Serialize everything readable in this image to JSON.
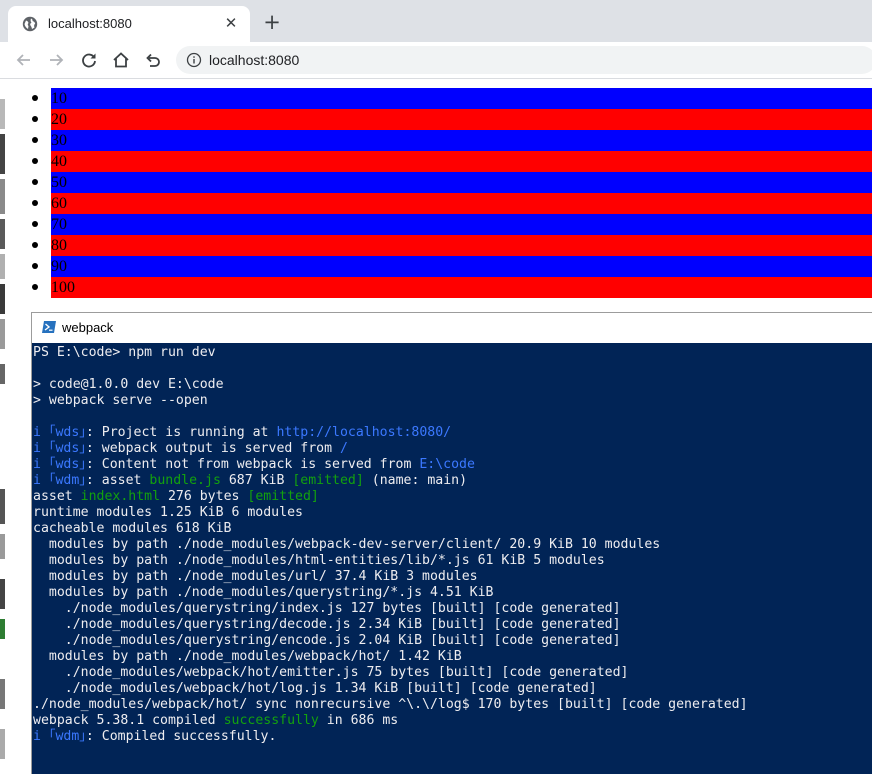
{
  "browser": {
    "tab": {
      "title": "localhost:8080",
      "close": "✕"
    },
    "new_tab": "+",
    "address": {
      "url": "localhost:8080"
    }
  },
  "page": {
    "items": [
      "10",
      "20",
      "30",
      "40",
      "50",
      "60",
      "70",
      "80",
      "90",
      "100"
    ],
    "colors": {
      "odd": "#0000ff",
      "even": "#ff0000"
    }
  },
  "terminal": {
    "title": "webpack",
    "colors": {
      "background": "#012456",
      "text": "#eeedf0",
      "blue": "#3b78ff",
      "green": "#13a10e"
    },
    "lines": [
      {
        "text": "PS E:\\code> npm run dev"
      },
      {
        "text": ""
      },
      {
        "text": "> code@1.0.0 dev E:\\code"
      },
      {
        "text": "> webpack serve --open"
      },
      {
        "text": ""
      },
      {
        "segments": [
          {
            "t": "i ｢wds｣",
            "c": "blue"
          },
          {
            "t": ": Project is running at "
          },
          {
            "t": "http://localhost:8080/",
            "c": "blue"
          }
        ]
      },
      {
        "segments": [
          {
            "t": "i ｢wds｣",
            "c": "blue"
          },
          {
            "t": ": webpack output is served from "
          },
          {
            "t": "/",
            "c": "blue"
          }
        ]
      },
      {
        "segments": [
          {
            "t": "i ｢wds｣",
            "c": "blue"
          },
          {
            "t": ": Content not from webpack is served from "
          },
          {
            "t": "E:\\code",
            "c": "blue"
          }
        ]
      },
      {
        "segments": [
          {
            "t": "i ｢wdm｣",
            "c": "blue"
          },
          {
            "t": ": asset "
          },
          {
            "t": "bundle.js",
            "c": "green"
          },
          {
            "t": " 687 KiB "
          },
          {
            "t": "[emitted]",
            "c": "green"
          },
          {
            "t": " (name: main)"
          }
        ]
      },
      {
        "segments": [
          {
            "t": "asset "
          },
          {
            "t": "index.html",
            "c": "green"
          },
          {
            "t": " 276 bytes "
          },
          {
            "t": "[emitted]",
            "c": "green"
          }
        ]
      },
      {
        "text": "runtime modules 1.25 KiB 6 modules"
      },
      {
        "text": "cacheable modules 618 KiB"
      },
      {
        "text": "  modules by path ./node_modules/webpack-dev-server/client/ 20.9 KiB 10 modules"
      },
      {
        "text": "  modules by path ./node_modules/html-entities/lib/*.js 61 KiB 5 modules"
      },
      {
        "text": "  modules by path ./node_modules/url/ 37.4 KiB 3 modules"
      },
      {
        "text": "  modules by path ./node_modules/querystring/*.js 4.51 KiB"
      },
      {
        "text": "    ./node_modules/querystring/index.js 127 bytes [built] [code generated]"
      },
      {
        "text": "    ./node_modules/querystring/decode.js 2.34 KiB [built] [code generated]"
      },
      {
        "text": "    ./node_modules/querystring/encode.js 2.04 KiB [built] [code generated]"
      },
      {
        "text": "  modules by path ./node_modules/webpack/hot/ 1.42 KiB"
      },
      {
        "text": "    ./node_modules/webpack/hot/emitter.js 75 bytes [built] [code generated]"
      },
      {
        "text": "    ./node_modules/webpack/hot/log.js 1.34 KiB [built] [code generated]"
      },
      {
        "text": "./node_modules/webpack/hot/ sync nonrecursive ^\\.\\/log$ 170 bytes [built] [code generated]"
      },
      {
        "segments": [
          {
            "t": "webpack 5.38.1 compiled "
          },
          {
            "t": "successfully",
            "c": "green"
          },
          {
            "t": " in 686 ms"
          }
        ]
      },
      {
        "segments": [
          {
            "t": "i ｢wdm｣",
            "c": "blue"
          },
          {
            "t": ": Compiled successfully."
          }
        ]
      }
    ]
  }
}
